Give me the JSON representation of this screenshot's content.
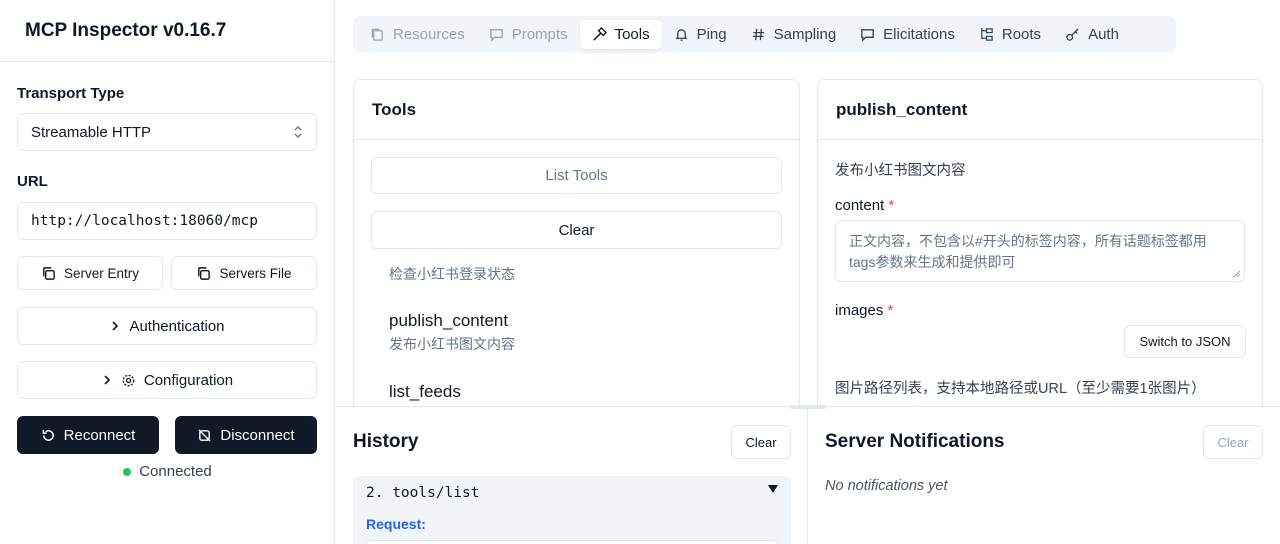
{
  "app": {
    "title": "MCP Inspector v0.16.7"
  },
  "sidebar": {
    "transport_label": "Transport Type",
    "transport_value": "Streamable HTTP",
    "url_label": "URL",
    "url_value": "http://localhost:18060/mcp",
    "server_entry": "Server Entry",
    "servers_file": "Servers File",
    "authentication": "Authentication",
    "configuration": "Configuration",
    "reconnect": "Reconnect",
    "disconnect": "Disconnect",
    "status": "Connected",
    "status_color": "#22c55e"
  },
  "tabs": [
    {
      "label": "Resources",
      "icon": "files-icon",
      "state": "disabled"
    },
    {
      "label": "Prompts",
      "icon": "message-icon",
      "state": "disabled"
    },
    {
      "label": "Tools",
      "icon": "hammer-icon",
      "state": "active"
    },
    {
      "label": "Ping",
      "icon": "bell-icon",
      "state": "normal"
    },
    {
      "label": "Sampling",
      "icon": "hash-icon",
      "state": "normal"
    },
    {
      "label": "Elicitations",
      "icon": "message-square-icon",
      "state": "normal"
    },
    {
      "label": "Roots",
      "icon": "folder-tree-icon",
      "state": "normal"
    },
    {
      "label": "Auth",
      "icon": "key-icon",
      "state": "normal"
    }
  ],
  "tools_panel": {
    "title": "Tools",
    "list_tools": "List Tools",
    "clear": "Clear",
    "items": [
      {
        "name": "",
        "desc": "检查小红书登录状态"
      },
      {
        "name": "publish_content",
        "desc": "发布小红书图文内容"
      },
      {
        "name": "list_feeds",
        "desc": ""
      }
    ]
  },
  "detail_panel": {
    "title": "publish_content",
    "description": "发布小红书图文内容",
    "content_label": "content",
    "content_placeholder": "正文内容，不包含以#开头的标签内容，所有话题标签都用tags参数来生成和提供即可",
    "images_label": "images",
    "switch_json": "Switch to JSON",
    "images_desc": "图片路径列表，支持本地路径或URL（至少需要1张图片）",
    "required_mark": "*"
  },
  "history": {
    "title": "History",
    "clear": "Clear",
    "entry_title": "2. tools/list",
    "request_label": "Request:"
  },
  "notifications": {
    "title": "Server Notifications",
    "clear": "Clear",
    "empty": "No notifications yet"
  }
}
